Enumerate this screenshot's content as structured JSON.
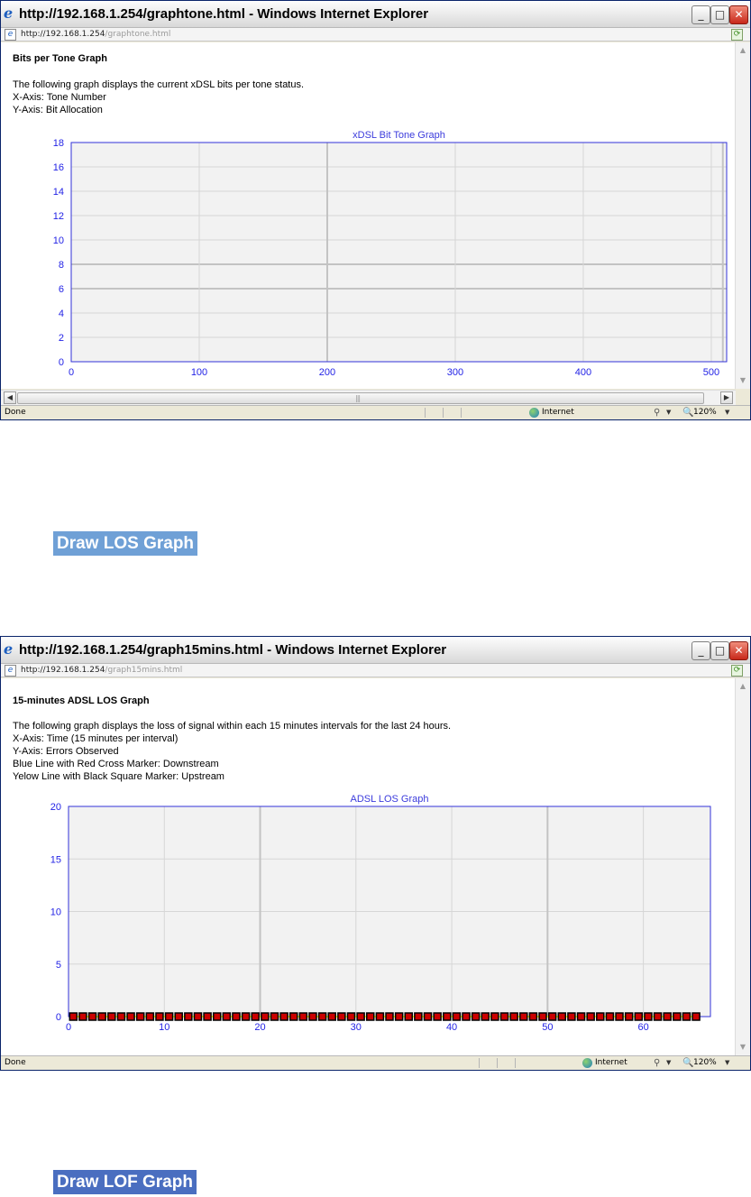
{
  "window1": {
    "title": "http://192.168.1.254/graphtone.html - Windows Internet Explorer",
    "address_host": "http://192.168.1.254",
    "address_path": "/graphtone.html",
    "page_heading": "Bits per Tone Graph",
    "description": "The following graph displays the current xDSL bits per tone status.",
    "x_axis_note": "X-Axis: Tone Number",
    "y_axis_note": "Y-Axis: Bit Allocation",
    "status": {
      "text": "Done",
      "zone": "Internet",
      "zoom": "120%"
    }
  },
  "window2": {
    "title": "http://192.168.1.254/graph15mins.html - Windows Internet Explorer",
    "address_host": "http://192.168.1.254",
    "address_path": "/graph15mins.html",
    "page_heading": "15-minutes ADSL LOS Graph",
    "description": "The following graph displays the loss of signal within each 15 minutes intervals for the last 24 hours.",
    "x_axis_note": "X-Axis: Time (15 minutes per interval)",
    "y_axis_note": "Y-Axis: Errors Observed",
    "downstream_note": "Blue Line with Red Cross Marker: Downstream",
    "upstream_note": "Yelow Line with Black Square Marker: Upstream",
    "status": {
      "text": "Done",
      "zone": "Internet",
      "zoom": "120%"
    }
  },
  "buttons": {
    "draw_los": "Draw LOS Graph",
    "draw_lof": "Draw LOF Graph"
  },
  "chart_data": [
    {
      "type": "line",
      "title": "xDSL Bit Tone Graph",
      "x_ticks": [
        0,
        100,
        200,
        300,
        400,
        500
      ],
      "y_ticks": [
        0,
        2,
        4,
        6,
        8,
        10,
        12,
        14,
        16,
        18
      ],
      "xlim": [
        0,
        512
      ],
      "ylim": [
        0,
        18
      ],
      "grid": true,
      "series": []
    },
    {
      "type": "line",
      "title": "ADSL LOS Graph",
      "x_ticks": [
        0,
        10,
        20,
        30,
        40,
        50,
        60
      ],
      "y_ticks": [
        0,
        5,
        10,
        15,
        20
      ],
      "xlim": [
        0,
        67
      ],
      "ylim": [
        0,
        20
      ],
      "grid": true,
      "series": [
        {
          "values": [
            0,
            0,
            0,
            0,
            0,
            0,
            0,
            0,
            0,
            0,
            0,
            0,
            0,
            0,
            0,
            0,
            0,
            0,
            0,
            0,
            0,
            0,
            0,
            0,
            0,
            0,
            0,
            0,
            0,
            0,
            0,
            0,
            0,
            0,
            0,
            0,
            0,
            0,
            0,
            0,
            0,
            0,
            0,
            0,
            0,
            0,
            0,
            0,
            0,
            0,
            0,
            0,
            0,
            0,
            0,
            0,
            0,
            0,
            0,
            0,
            0,
            0,
            0,
            0,
            0,
            0
          ],
          "line_color": "#0000ff",
          "marker": "red-cross"
        },
        {
          "values": [
            0,
            0,
            0,
            0,
            0,
            0,
            0,
            0,
            0,
            0,
            0,
            0,
            0,
            0,
            0,
            0,
            0,
            0,
            0,
            0,
            0,
            0,
            0,
            0,
            0,
            0,
            0,
            0,
            0,
            0,
            0,
            0,
            0,
            0,
            0,
            0,
            0,
            0,
            0,
            0,
            0,
            0,
            0,
            0,
            0,
            0,
            0,
            0,
            0,
            0,
            0,
            0,
            0,
            0,
            0,
            0,
            0,
            0,
            0,
            0,
            0,
            0,
            0,
            0,
            0,
            0
          ],
          "line_color": "#ffff00",
          "marker": "black-square"
        }
      ]
    }
  ]
}
